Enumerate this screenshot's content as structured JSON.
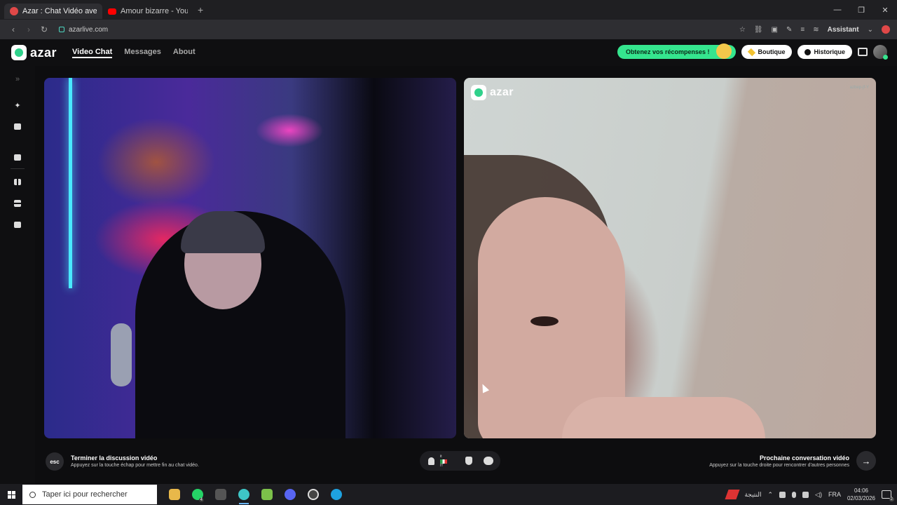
{
  "browser": {
    "tabs": [
      {
        "title": "Azar : Chat Vidéo avec de",
        "active": true,
        "favicon": "azar-favicon"
      },
      {
        "title": "Amour bizarre - YouTube",
        "active": false,
        "favicon": "youtube-favicon"
      }
    ],
    "new_tab": "+",
    "url": "azarlive.com",
    "assistant_label": "Assistant",
    "window_controls": {
      "minimize": "—",
      "restore": "❐",
      "close": "✕"
    }
  },
  "app": {
    "brand": "azar",
    "nav": [
      {
        "label": "Video Chat",
        "active": true
      },
      {
        "label": "Messages",
        "active": false
      },
      {
        "label": "About",
        "active": false
      }
    ],
    "rewards_label": "Obtenez vos récompenses !",
    "shop_label": "Boutique",
    "history_label": "Historique"
  },
  "sidebar": {
    "icons": [
      "expand-icon",
      "magic-wand-icon",
      "sticker-icon",
      "camera-flip-icon",
      "layout-side-icon",
      "layout-stack-icon",
      "layout-grid-icon"
    ],
    "expand_glyph": "»"
  },
  "remote_video": {
    "watermark": "azar",
    "user_id": "azbep-jf-Y"
  },
  "controls": {
    "esc_label": "esc",
    "end_title": "Terminer la discussion vidéo",
    "end_subtitle": "Appuyez sur la touche échap pour mettre fin au chat vidéo.",
    "partner_lang": "it",
    "partner_country": "IT",
    "next_title": "Prochaine conversation vidéo",
    "next_subtitle": "Appuyez sur la touche droite pour rencontrer d'autres personnes",
    "next_glyph": "→"
  },
  "taskbar": {
    "search_placeholder": "Taper ici pour rechercher",
    "apps": [
      {
        "icon": "file-explorer-icon",
        "color": "#e8b84a"
      },
      {
        "icon": "whatsapp-icon",
        "color": "#25d366",
        "badge": "4"
      },
      {
        "icon": "app-icon",
        "color": "#555555"
      },
      {
        "icon": "browser-active-icon",
        "color": "#3ec6c6",
        "active": true
      },
      {
        "icon": "android-icon",
        "color": "#7cc14a"
      },
      {
        "icon": "discord-icon",
        "color": "#5865f2"
      },
      {
        "icon": "obs-icon",
        "color": "#444444"
      },
      {
        "icon": "edge-icon",
        "color": "#1ea2e0"
      }
    ],
    "weather_text": "النتيجة",
    "language": "FRA",
    "time": "04:06",
    "date": "02/03/2026",
    "notifications": "2"
  }
}
